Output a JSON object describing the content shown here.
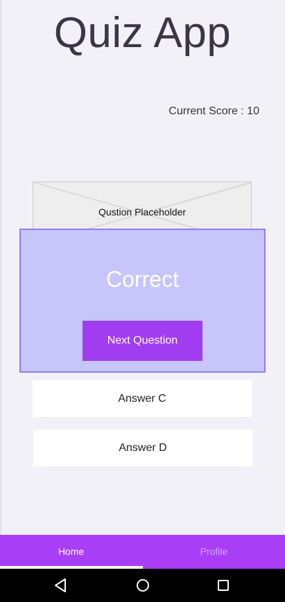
{
  "app": {
    "title": "Quiz App"
  },
  "score": {
    "text": "Current Score : 10"
  },
  "question": {
    "placeholder_text": "Qustion Placeholder"
  },
  "result": {
    "text": "Correct",
    "next_button_label": "Next Question"
  },
  "answers": [
    {
      "label": "Answer C"
    },
    {
      "label": "Answer D"
    }
  ],
  "bottom_nav": {
    "items": [
      {
        "label": "Home",
        "active": true
      },
      {
        "label": "Profile",
        "active": false
      }
    ]
  },
  "system_nav": {
    "icons": [
      "back-icon",
      "home-circle-icon",
      "recent-apps-icon"
    ]
  },
  "colors": {
    "background": "#f3f1f8",
    "overlay": "#c6c6fa",
    "overlay_border": "#8f7ef0",
    "accent": "#a13df0",
    "nav_bar": "#a83ef6"
  }
}
